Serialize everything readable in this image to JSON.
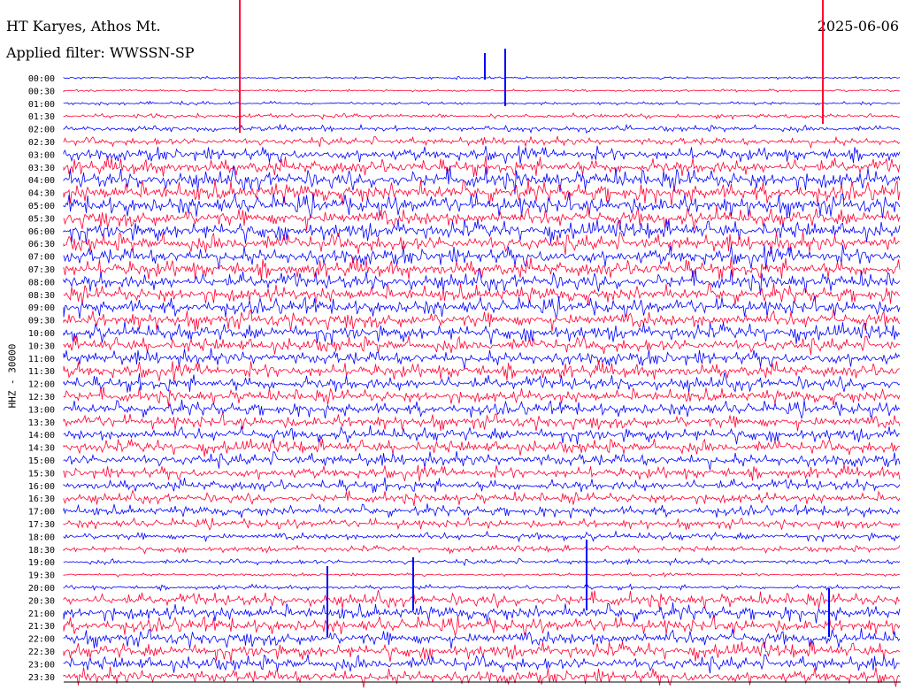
{
  "header": {
    "station": "HT Karyes, Athos Mt.",
    "filter": "Applied filter: WWSSN-SP",
    "date": "2025-06-06"
  },
  "chart_data": {
    "type": "line",
    "title": "HT Karyes, Athos Mt.",
    "ylabel": "HHZ - 30000",
    "xlabel": "",
    "colors": [
      "#0000ff",
      "#ff0033"
    ],
    "rows": [
      {
        "time": "00:00",
        "amp": 0.15
      },
      {
        "time": "00:30",
        "amp": 0.15
      },
      {
        "time": "01:00",
        "amp": 0.2
      },
      {
        "time": "01:30",
        "amp": 0.3
      },
      {
        "time": "02:00",
        "amp": 0.4
      },
      {
        "time": "02:30",
        "amp": 0.55
      },
      {
        "time": "03:00",
        "amp": 0.9
      },
      {
        "time": "03:30",
        "amp": 1.1
      },
      {
        "time": "04:00",
        "amp": 1.3
      },
      {
        "time": "04:30",
        "amp": 1.3
      },
      {
        "time": "05:00",
        "amp": 1.3
      },
      {
        "time": "05:30",
        "amp": 1.2
      },
      {
        "time": "06:00",
        "amp": 1.2
      },
      {
        "time": "06:30",
        "amp": 1.2
      },
      {
        "time": "07:00",
        "amp": 1.2
      },
      {
        "time": "07:30",
        "amp": 1.2
      },
      {
        "time": "08:00",
        "amp": 1.2
      },
      {
        "time": "08:30",
        "amp": 1.1
      },
      {
        "time": "09:00",
        "amp": 1.1
      },
      {
        "time": "09:30",
        "amp": 1.1
      },
      {
        "time": "10:00",
        "amp": 1.1
      },
      {
        "time": "10:30",
        "amp": 1.0
      },
      {
        "time": "11:00",
        "amp": 1.0
      },
      {
        "time": "11:30",
        "amp": 1.0
      },
      {
        "time": "12:00",
        "amp": 1.0
      },
      {
        "time": "12:30",
        "amp": 0.9
      },
      {
        "time": "13:00",
        "amp": 0.9
      },
      {
        "time": "13:30",
        "amp": 0.9
      },
      {
        "time": "14:00",
        "amp": 0.9
      },
      {
        "time": "14:30",
        "amp": 0.9
      },
      {
        "time": "15:00",
        "amp": 0.9
      },
      {
        "time": "15:30",
        "amp": 0.8
      },
      {
        "time": "16:00",
        "amp": 0.8
      },
      {
        "time": "16:30",
        "amp": 0.7
      },
      {
        "time": "17:00",
        "amp": 0.7
      },
      {
        "time": "17:30",
        "amp": 0.6
      },
      {
        "time": "18:00",
        "amp": 0.5
      },
      {
        "time": "18:30",
        "amp": 0.4
      },
      {
        "time": "19:00",
        "amp": 0.35
      },
      {
        "time": "19:30",
        "amp": 0.2
      },
      {
        "time": "20:00",
        "amp": 0.3
      },
      {
        "time": "20:30",
        "amp": 0.9
      },
      {
        "time": "21:00",
        "amp": 1.0
      },
      {
        "time": "21:30",
        "amp": 1.0
      },
      {
        "time": "22:00",
        "amp": 1.0
      },
      {
        "time": "22:30",
        "amp": 1.0
      },
      {
        "time": "23:00",
        "amp": 1.0
      },
      {
        "time": "23:30",
        "amp": 1.0
      }
    ]
  }
}
